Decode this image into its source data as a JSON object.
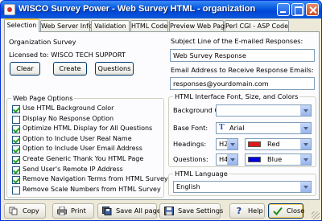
{
  "window": {
    "title": "WISCO Survey Power - Web Survey HTML - organization"
  },
  "tabs": [
    "Selection",
    "Web Server Info",
    "Validation",
    "HTML Code",
    "Preview Web Page",
    "Perl CGI - ASP Code"
  ],
  "left": {
    "org_label": "Organization Survey",
    "licensed": "Licensed to: WISCO TECH SUPPORT",
    "buttons": {
      "clear": "Clear",
      "create": "Create",
      "questions": "Questions"
    },
    "options_title": "Web Page Options",
    "options": [
      {
        "label": "Use HTML Background Color",
        "checked": true
      },
      {
        "label": "Display No Response Option",
        "checked": false
      },
      {
        "label": "Optimize HTML Display for All Questions",
        "checked": true
      },
      {
        "label": "Option to Include User Real Name",
        "checked": true
      },
      {
        "label": "Option to Include User Email Address",
        "checked": true
      },
      {
        "label": "Create Generic Thank You HTML Page",
        "checked": true
      },
      {
        "label": "Send User's Remote IP Address",
        "checked": true
      },
      {
        "label": "Remove Navigation Terms from HTML Survey",
        "checked": true
      },
      {
        "label": "Remove Scale Numbers from HTML Survey",
        "checked": false
      }
    ]
  },
  "right": {
    "subject_label": "Subject Line of the E-mailed Responses:",
    "subject_value": "Web Survey Response",
    "email_label": "Email Address to Receive Response Emails:",
    "email_value": "responses@yourdomain.com",
    "interface_title": "HTML Interface Font, Size, and Colors",
    "bg_color_label": "Background Color:",
    "base_font_label": "Base Font:",
    "base_font_icon_text": "T",
    "base_font_value": "Arial",
    "headings_label": "Headings:",
    "headings_size": "H2",
    "headings_color_name": "Red",
    "headings_color": "#e01818",
    "questions_label": "Questions:",
    "questions_size": "H4",
    "questions_color_name": "Blue",
    "questions_color": "#0000e0",
    "language_title": "HTML Language",
    "language_value": "English"
  },
  "bottom": {
    "copy": "Copy",
    "print": "Print",
    "save_all": "Save All pages",
    "save_settings": "Save Settings",
    "help": "Help",
    "close": "Close"
  }
}
